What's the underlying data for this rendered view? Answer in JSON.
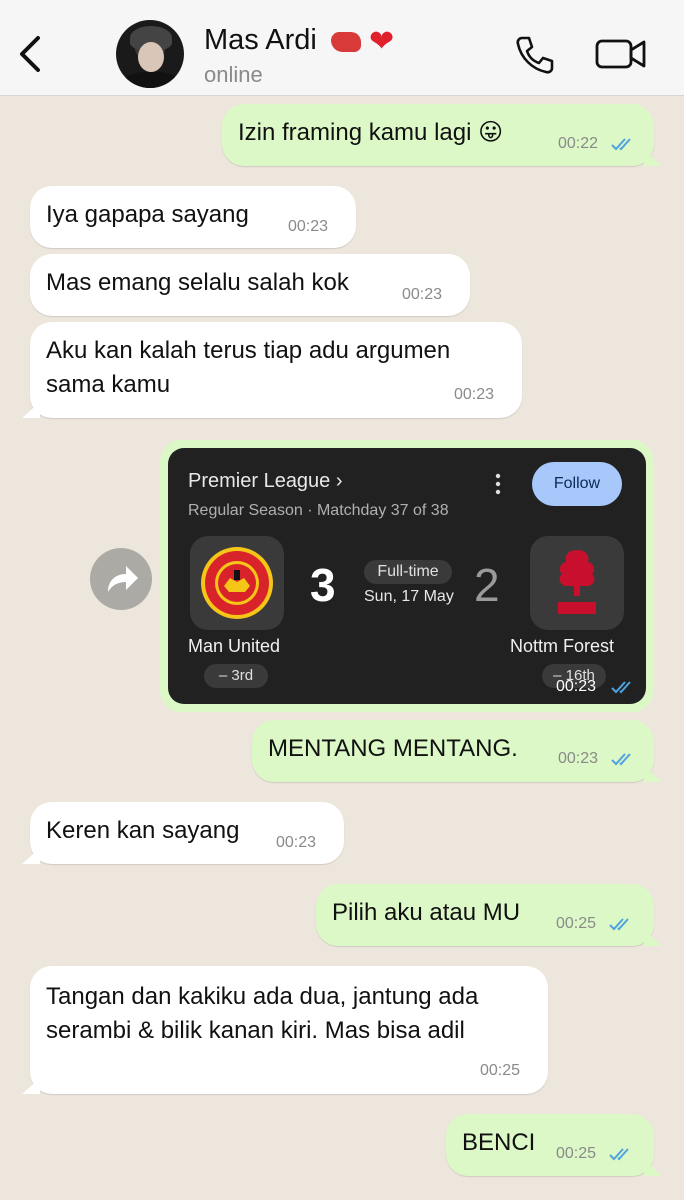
{
  "header": {
    "contact_name": "Mas Ardi",
    "status": "online"
  },
  "messages": [
    {
      "text": "Izin framing kamu lagi 😛",
      "time": "00:22",
      "dir": "out"
    },
    {
      "text": "Iya gapapa sayang",
      "time": "00:23",
      "dir": "in"
    },
    {
      "text": "Mas emang selalu salah kok",
      "time": "00:23",
      "dir": "in"
    },
    {
      "text_line1": "Aku kan kalah terus tiap adu argumen",
      "text_line2": "sama kamu",
      "time": "00:23",
      "dir": "in"
    },
    {
      "text": "MENTANG MENTANG.",
      "time": "00:23",
      "dir": "out"
    },
    {
      "text": "Keren kan sayang",
      "time": "00:23",
      "dir": "in"
    },
    {
      "text": "Pilih aku atau MU",
      "time": "00:25",
      "dir": "out"
    },
    {
      "text_line1": "Tangan dan kakiku ada dua, jantung ada",
      "text_line2": "serambi & bilik kanan kiri. Mas bisa adil",
      "time": "00:25",
      "dir": "in"
    },
    {
      "text": "BENCI",
      "time": "00:25",
      "dir": "out"
    }
  ],
  "match_card": {
    "league": "Premier League ›",
    "season": "Regular Season · Matchday 37 of 38",
    "follow_label": "Follow",
    "home_team": "Man United",
    "home_score": "3",
    "home_rank": "–  3rd",
    "away_team": "Nottm Forest",
    "away_score": "2",
    "away_rank": "–  16th",
    "status": "Full-time",
    "date": "Sun, 17 May",
    "time": "00:23",
    "home_logo_text": "MANCHESTER UNITED",
    "away_logo_text": "FOREST"
  },
  "colors": {
    "outgoing_bubble": "#dcf8c6",
    "incoming_bubble": "#ffffff",
    "tick_blue": "#4fa3e0",
    "card_bg": "#212121",
    "follow_button": "#a8c7fa"
  }
}
